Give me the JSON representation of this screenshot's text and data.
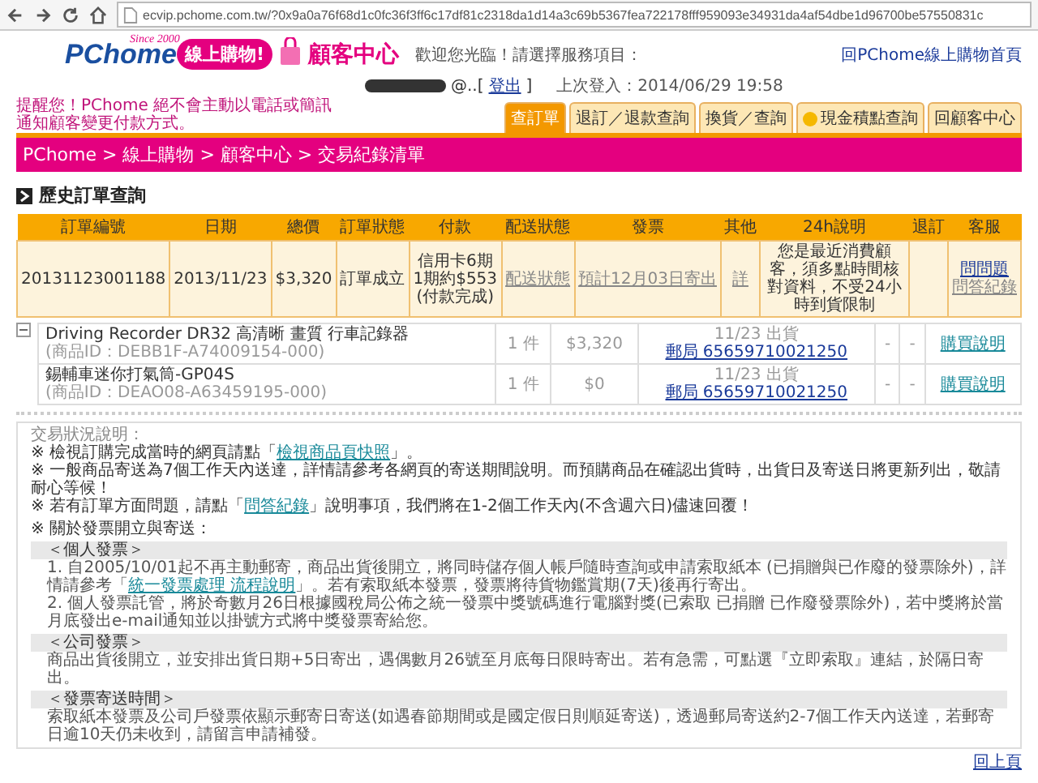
{
  "address_bar": {
    "url": "ecvip.pchome.com.tw/?0x9a0a76f68d1c0fc36f3ff6c17df81c2318da1d14a3c69b5367fea722178fff959093e34931da4af54dbe1d96700be57550831c"
  },
  "header": {
    "logo": {
      "brand": "PChome",
      "since": "Since 2000",
      "badge": "線上購物!"
    },
    "center_title": "顧客中心",
    "welcome": "歡迎您光臨！請選擇服務項目：",
    "home_link": "回PChome線上購物首頁",
    "user_suffix": "@..[",
    "logout": "登出",
    "user_close": "]",
    "last_login": "上次登入：2014/06/29 19:58",
    "notice": "提醒您！PChome 絕不會主動以電話或簡訊通知顧客變更付款方式。"
  },
  "tabs": [
    {
      "label": "查訂單",
      "selected": true,
      "kind": "plain"
    },
    {
      "label": "退訂／退款查詢",
      "selected": false,
      "kind": "plain"
    },
    {
      "label": "換貨／查詢",
      "selected": false,
      "kind": "plain"
    },
    {
      "label": "現金積點查詢",
      "selected": false,
      "kind": "coin"
    },
    {
      "label": "回顧客中心",
      "selected": false,
      "kind": "plain"
    }
  ],
  "breadcrumb": "PChome > 線上購物 > 顧客中心 > 交易紀錄清單",
  "section_title": "歷史訂單查詢",
  "order_table": {
    "columns": [
      "訂單編號",
      "日期",
      "總價",
      "訂單狀態",
      "付款",
      "配送狀態",
      "發票",
      "其他",
      "24h說明",
      "退訂",
      "客服"
    ],
    "order": {
      "number": "20131123001188",
      "date": "2013/11/23",
      "total": "$3,320",
      "status": "訂單成立",
      "payment": [
        "信用卡6期",
        "1期約$553",
        "(付款完成)"
      ],
      "delivery": "配送狀態",
      "invoice": "預計12月03日寄出",
      "other": "詳",
      "note": "您是最近消費顧客，須多點時間核對資料，不受24小時到貨限制",
      "service": [
        "問問題",
        "問答紀錄"
      ]
    },
    "items": [
      {
        "name": "Driving Recorder DR32 高清晰 畫質 行車記錄器",
        "id": "(商品ID：DEBB1F-A74009154-000)",
        "qty": "1 件",
        "price": "$3,320",
        "shipped": "11/23 出貨",
        "tracking": "郵局 65659710021250",
        "col_a": "-",
        "col_b": "-",
        "help": "購買說明"
      },
      {
        "name": "錫輔車迷你打氣筒-GP04S",
        "id": "(商品ID：DEAO08-A63459195-000)",
        "qty": "1 件",
        "price": "$0",
        "shipped": "11/23 出貨",
        "tracking": "郵局 65659710021250",
        "col_a": "-",
        "col_b": "-",
        "help": "購買說明"
      }
    ]
  },
  "notes": {
    "title": "交易狀況說明：",
    "lines": [
      {
        "before": "※ 檢視訂購完成當時的網頁請點「",
        "link": "檢視商品頁快照",
        "after": "」。"
      },
      {
        "before": "※ 一般商品寄送為7個工作天內送達，詳情請參考各網頁的寄送期間說明。而預購商品在確認出貨時，出貨日及寄送日將更新列出，敬請耐心等候！"
      },
      {
        "before": "※ 若有訂單方面問題，請點「",
        "link": "問答紀錄",
        "after": "」說明事項，我們將在1-2個工作天內(不含週六日)儘速回覆！"
      }
    ],
    "invoice_title": "※ 關於發票開立與寄送：",
    "sections": [
      {
        "heading": "＜個人發票＞",
        "paragraphs": [
          {
            "before": "1. 自2005/10/01起不再主動郵寄，商品出貨後開立，將同時儲存個人帳戶隨時查詢或申請索取紙本 (已捐贈與已作廢的發票除外)，詳情請參考「",
            "link": "統一發票處理 流程說明",
            "after": "」。若有索取紙本發票，發票將待貨物鑑賞期(7天)後再行寄出。"
          },
          {
            "before": "2. 個人發票託管，將於奇數月26日根據國稅局公佈之統一發票中獎號碼進行電腦對獎(已索取 已捐贈 已作廢發票除外)，若中獎將於當月底發出e-mail通知並以掛號方式將中獎發票寄給您。"
          }
        ]
      },
      {
        "heading": "＜公司發票＞",
        "paragraphs": [
          {
            "before": "商品出貨後開立，並安排出貨日期+5日寄出，遇偶數月26號至月底每日限時寄出。若有急需，可點選『立即索取』連結，於隔日寄出。"
          }
        ]
      },
      {
        "heading": "＜發票寄送時間＞",
        "paragraphs": [
          {
            "before": "索取紙本發票及公司戶發票依顯示郵寄日寄送(如遇春節期間或是國定假日則順延寄送)，透過郵局寄送約2-7個工作天內送達，若郵寄日逾10天仍未收到，請留言申請補發。"
          }
        ]
      }
    ]
  },
  "back_to_top": "回上頁"
}
